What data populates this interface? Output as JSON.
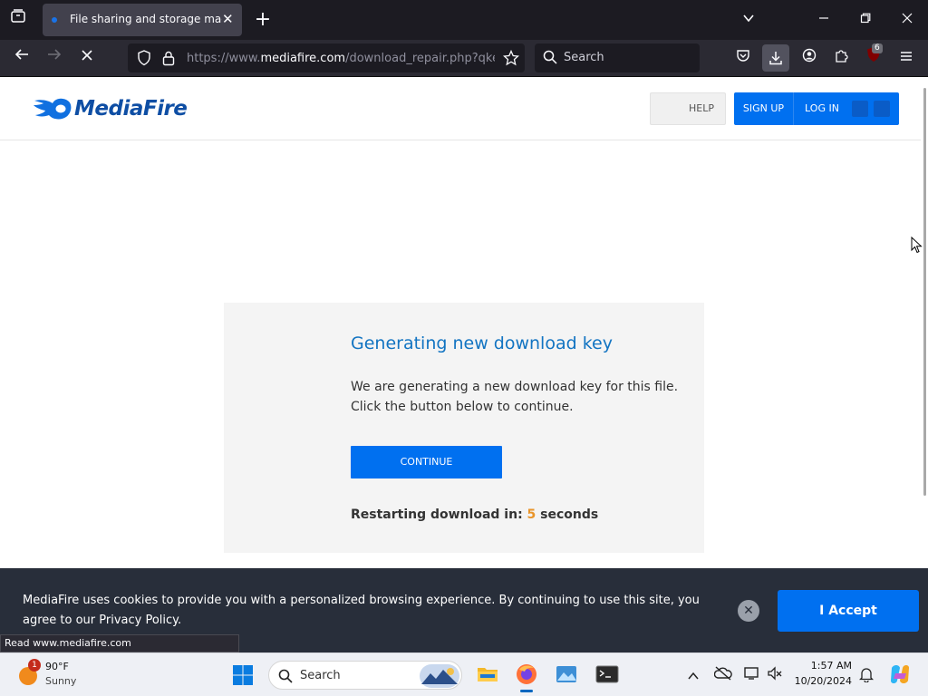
{
  "browser": {
    "tab_title": "File sharing and storage made s",
    "new_tab": "+",
    "url_prefix": "https://www.",
    "url_domain": "mediafire.com",
    "url_path": "/download_repair.php?qkey=",
    "search_placeholder": "Search",
    "ublock_badge": "6",
    "status_text": "Read www.mediafire.com"
  },
  "site": {
    "logo_text": "MediaFire",
    "help_label": "HELP",
    "signup_label": "SIGN UP",
    "login_label": "LOG IN"
  },
  "card": {
    "title": "Generating new download key",
    "desc_line1": "We are generating a new download key for this file.",
    "desc_line2": "Click the button below to continue.",
    "continue_label": "CONTINUE",
    "restart_prefix": "Restarting download in: ",
    "restart_seconds": "5",
    "restart_suffix": " seconds"
  },
  "cookie": {
    "line1": "MediaFire uses cookies to provide you with a personalized browsing experience. By continuing to use this site, you",
    "line2": "agree to our Privacy Policy.",
    "close_label": "✕",
    "accept_label": "I Accept"
  },
  "taskbar": {
    "weather_temp": "90°F",
    "weather_condition": "Sunny",
    "weather_badge": "1",
    "search_label": "Search",
    "time": "1:57 AM",
    "date": "10/20/2024"
  },
  "colors": {
    "brand_blue": "#0070f0",
    "title_blue": "#1274c2",
    "countdown_orange": "#e9952a"
  }
}
